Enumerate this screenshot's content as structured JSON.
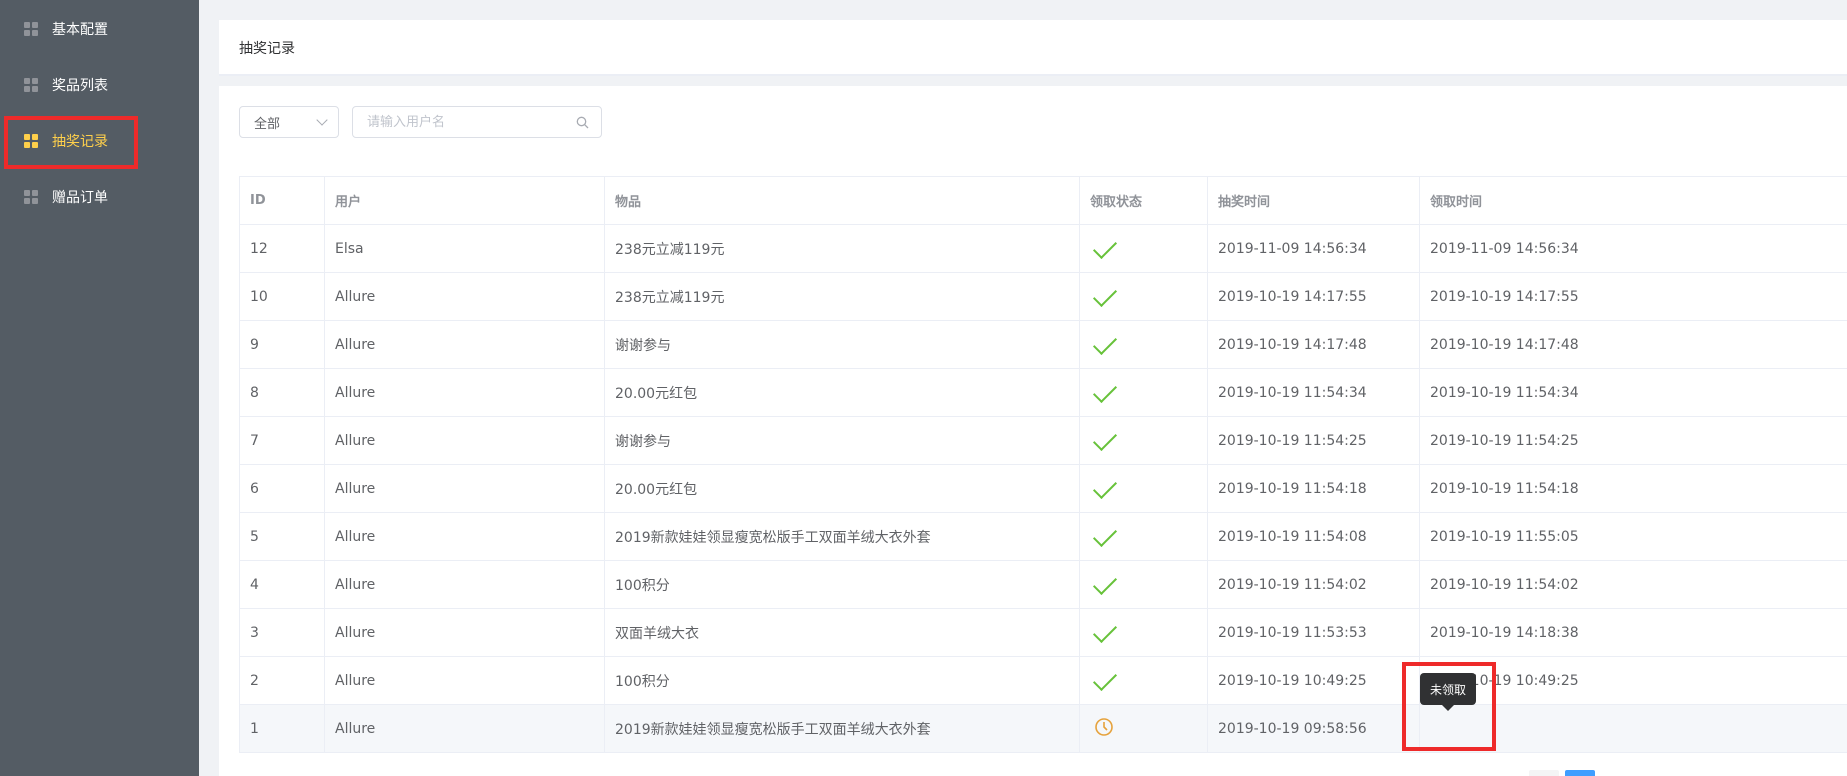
{
  "sidebar": {
    "items": [
      {
        "label": "基本配置",
        "icon": "grid-icon",
        "active": false
      },
      {
        "label": "奖品列表",
        "icon": "grid-icon",
        "active": false
      },
      {
        "label": "抽奖记录",
        "icon": "grid-icon",
        "active": true
      },
      {
        "label": "赠品订单",
        "icon": "grid-icon",
        "active": false
      }
    ]
  },
  "header": {
    "title": "抽奖记录"
  },
  "filters": {
    "select_value": "全部",
    "search_placeholder": "请输入用户名"
  },
  "table": {
    "columns": [
      "ID",
      "用户",
      "物品",
      "领取状态",
      "抽奖时间",
      "领取时间"
    ],
    "rows": [
      {
        "id": "12",
        "user": "Elsa",
        "item": "238元立减119元",
        "status": "claimed",
        "draw_time": "2019-11-09 14:56:34",
        "claim_time": "2019-11-09 14:56:34"
      },
      {
        "id": "10",
        "user": "Allure",
        "item": "238元立减119元",
        "status": "claimed",
        "draw_time": "2019-10-19 14:17:55",
        "claim_time": "2019-10-19 14:17:55"
      },
      {
        "id": "9",
        "user": "Allure",
        "item": "谢谢参与",
        "status": "claimed",
        "draw_time": "2019-10-19 14:17:48",
        "claim_time": "2019-10-19 14:17:48"
      },
      {
        "id": "8",
        "user": "Allure",
        "item": "20.00元红包",
        "status": "claimed",
        "draw_time": "2019-10-19 11:54:34",
        "claim_time": "2019-10-19 11:54:34"
      },
      {
        "id": "7",
        "user": "Allure",
        "item": "谢谢参与",
        "status": "claimed",
        "draw_time": "2019-10-19 11:54:25",
        "claim_time": "2019-10-19 11:54:25"
      },
      {
        "id": "6",
        "user": "Allure",
        "item": "20.00元红包",
        "status": "claimed",
        "draw_time": "2019-10-19 11:54:18",
        "claim_time": "2019-10-19 11:54:18"
      },
      {
        "id": "5",
        "user": "Allure",
        "item": "2019新款娃娃领显瘦宽松版手工双面羊绒大衣外套",
        "status": "claimed",
        "draw_time": "2019-10-19 11:54:08",
        "claim_time": "2019-10-19 11:55:05"
      },
      {
        "id": "4",
        "user": "Allure",
        "item": "100积分",
        "status": "claimed",
        "draw_time": "2019-10-19 11:54:02",
        "claim_time": "2019-10-19 11:54:02"
      },
      {
        "id": "3",
        "user": "Allure",
        "item": "双面羊绒大衣",
        "status": "claimed",
        "draw_time": "2019-10-19 11:53:53",
        "claim_time": "2019-10-19 14:18:38"
      },
      {
        "id": "2",
        "user": "Allure",
        "item": "100积分",
        "status": "claimed",
        "draw_time": "2019-10-19 10:49:25",
        "claim_time": "2019-10-19 10:49:25"
      },
      {
        "id": "1",
        "user": "Allure",
        "item": "2019新款娃娃领显瘦宽松版手工双面羊绒大衣外套",
        "status": "unclaimed",
        "draw_time": "2019-10-19 09:58:56",
        "claim_time": ""
      }
    ]
  },
  "tooltip": {
    "text": "未领取"
  },
  "colors": {
    "sidebar_bg": "#545c64",
    "active_accent": "#ffd04b",
    "claimed_green": "#67c23a",
    "unclaimed_orange": "#e6a23c",
    "annotation_red": "#ee2a2a",
    "pager_blue": "#409eff"
  }
}
